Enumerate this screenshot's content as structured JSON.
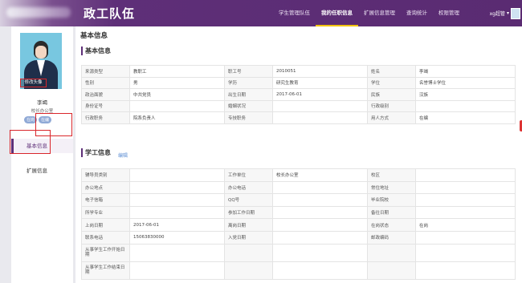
{
  "header": {
    "brand": "政工队伍",
    "nav": [
      "学生管理队伍",
      "我的任职信息",
      "扩展信息管理",
      "查询统计",
      "权限管理"
    ],
    "active_nav": 1,
    "user": "xg超管",
    "user_caret": "▾"
  },
  "sidebar": {
    "edit_photo": "修改头像",
    "name": "李竭",
    "dept": "校长办公室",
    "tags": [
      "在岗",
      "在编"
    ],
    "menu": [
      "基本信息",
      "扩展信息"
    ]
  },
  "main": {
    "page_title": "基本信息",
    "basic_title": "基本信息",
    "xg_title": "学工信息",
    "xg_edit": "编辑",
    "basic_rows": [
      [
        "来源类型",
        "教职工",
        "职工号",
        "2010051",
        "姓名",
        "李竭"
      ],
      [
        "性别",
        "男",
        "学历",
        "研究生教育",
        "学位",
        "名誉博士学位"
      ],
      [
        "政治面貌",
        "中共党员",
        "出生日期",
        "2017-06-01",
        "民族",
        "汉族"
      ],
      [
        "身份证号",
        "",
        "婚姻状况",
        "",
        "行政级别",
        ""
      ],
      [
        "行政职务",
        "院系负责人",
        "专技职务",
        "",
        "用人方式",
        "在编"
      ]
    ],
    "xg_rows": [
      [
        "辅导员类别",
        "",
        "工作单位",
        "校长办公室",
        "校区",
        ""
      ],
      [
        "办公地点",
        "",
        "办公电话",
        "",
        "常住地址",
        ""
      ],
      [
        "电子信箱",
        "",
        "QQ号",
        "",
        "毕业院校",
        ""
      ],
      [
        "所学专业",
        "",
        "参加工作日期",
        "",
        "备往日期",
        ""
      ],
      [
        "上岗日期",
        "2017-06-01",
        "离岗日期",
        "",
        "在岗状态",
        "在岗"
      ],
      [
        "联系电话",
        "15063830000",
        "入党日期",
        "",
        "邮政编码",
        ""
      ],
      [
        "从事学生工作开始日期",
        "",
        "",
        "",
        "",
        ""
      ],
      [
        "从事学生工作结束日期",
        "",
        "",
        "",
        "",
        ""
      ]
    ]
  }
}
